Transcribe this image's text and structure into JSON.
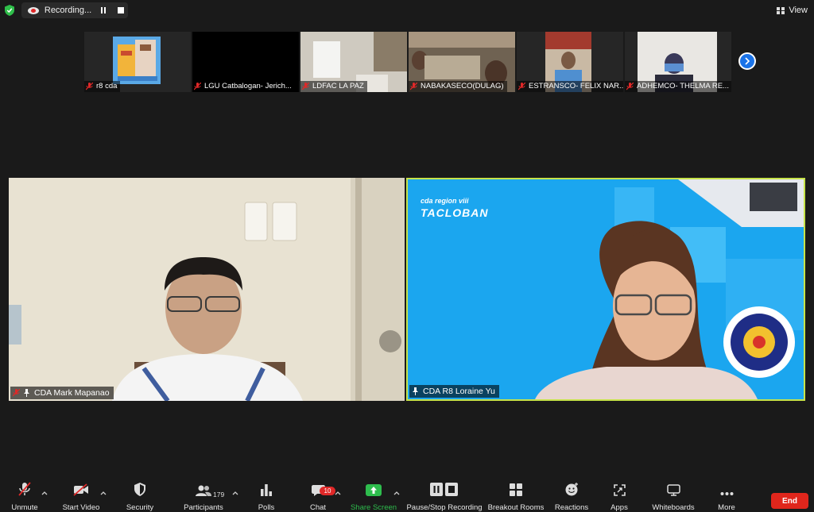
{
  "top_bar": {
    "recording_label": "Recording...",
    "view_label": "View"
  },
  "thumbnails": [
    {
      "name": "r8 cda"
    },
    {
      "name": "LGU Catbalogan- Jerich..."
    },
    {
      "name": "LDFAC LA PAZ"
    },
    {
      "name": "NABAKASECO(DULAG)"
    },
    {
      "name": "ESTRANSCO- FELIX NAR..."
    },
    {
      "name": "ADHEMCO- THELMA RE..."
    }
  ],
  "main_tiles": {
    "left": {
      "name": "CDA Mark Mapanao"
    },
    "right": {
      "name": "CDA R8 Loraine Yu",
      "bg_line1": "cda region viii",
      "bg_line2": "TACLOBAN"
    }
  },
  "toolbar": {
    "unmute": "Unmute",
    "start_video": "Start Video",
    "security": "Security",
    "participants": "Participants",
    "participant_count": "179",
    "polls": "Polls",
    "chat": "Chat",
    "chat_badge": "10",
    "share_screen": "Share Screen",
    "pause_stop_recording": "Pause/Stop Recording",
    "breakout_rooms": "Breakout Rooms",
    "reactions": "Reactions",
    "apps": "Apps",
    "whiteboards": "Whiteboards",
    "more": "More",
    "end": "End"
  },
  "colors": {
    "active_speaker_border": "#c6e34a",
    "share_screen_green": "#2ebd4d",
    "end_red": "#e0261c",
    "mic_muted_red": "#e02828"
  }
}
